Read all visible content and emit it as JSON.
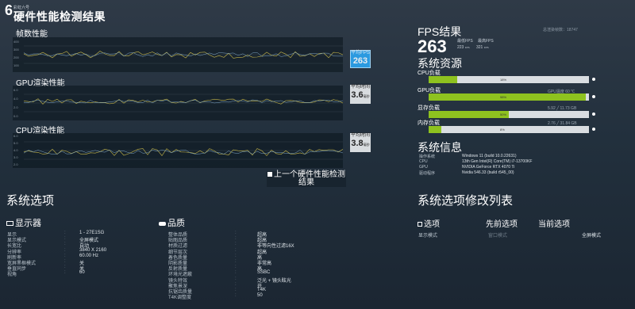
{
  "header": {
    "logo": "6",
    "sub": "彩虹六号",
    "title": "硬件性能检测结果"
  },
  "charts": [
    {
      "label": "帧数性能",
      "badge_label": "平均FPS",
      "badge_value": "263",
      "yticks": [
        "400",
        "300",
        "200",
        "100"
      ],
      "ylabel": "FPS"
    },
    {
      "label": "GPU渲染性能",
      "badge_label": "平均时间",
      "badge_value": "3.6",
      "badge_unit": "毫秒",
      "yticks": [
        "6.0",
        "4.0",
        "2.0",
        "0.0"
      ],
      "ylabel": "毫秒"
    },
    {
      "label": "CPU渲染性能",
      "badge_label": "平均时间",
      "badge_value": "3.8",
      "badge_unit": "毫秒",
      "yticks": [
        "6.0",
        "5.0",
        "4.0",
        "3.0",
        "2.0"
      ],
      "ylabel": "毫秒"
    }
  ],
  "fps": {
    "title": "FPS结果",
    "total_label": "总渲染帧数：",
    "total_value": "18747",
    "avg": "263",
    "min_label": "最低FPS",
    "max_label": "最高FPS",
    "min_value": "223",
    "max_value": "321",
    "min_unit": "FPS",
    "max_unit": "FPS"
  },
  "resources": {
    "title": "系统资源",
    "items": [
      {
        "label": "CPU负载",
        "pct": "18%",
        "fill": 0.18,
        "right": ""
      },
      {
        "label": "GPU负载",
        "pct": "98%",
        "fill": 0.98,
        "right": "GPU温度 60 ℃"
      },
      {
        "label": "显存负载",
        "pct": "50%",
        "fill": 0.5,
        "right": "5.92 ╱ 11.73 GB"
      },
      {
        "label": "内存负载",
        "pct": "8%",
        "fill": 0.08,
        "right": "2.76 ╱ 31.84 GB"
      }
    ]
  },
  "sysinfo": {
    "title": "系统信息",
    "rows": [
      [
        "操作系统",
        "Windows 11 (build 10.0.22631)"
      ],
      [
        "CPU",
        "13th Gen Intel(R) Core(TM) i7-13700KF"
      ],
      [
        "GPU",
        "NVIDIA GeForce RTX 4070 Ti"
      ],
      [
        "驱动程序",
        "Nvidia 546.33 (build r545_00)"
      ]
    ]
  },
  "center_button": "上一个硬件性能检测结果",
  "options": {
    "title": "系统选项",
    "display": {
      "title": "显示器",
      "rows": [
        [
          "显示",
          "1 - 27E1SG"
        ],
        [
          "显示模式",
          "全屏模式"
        ],
        [
          "长宽比",
          "自动"
        ],
        [
          "分辨率",
          "3840 X 2160"
        ],
        [
          "刷新率",
          "60.00 Hz"
        ],
        [
          "宽屏黑框模式",
          "关"
        ],
        [
          "垂直同步",
          "关"
        ],
        [
          "视角",
          "60"
        ]
      ]
    },
    "quality": {
      "title": "品质",
      "rows": [
        [
          "整体品质",
          "超高"
        ],
        [
          "贴图品质",
          "超高"
        ],
        [
          "材质过滤",
          "非等向性过滤16X"
        ],
        [
          "细节层次",
          "超高"
        ],
        [
          "着色质量",
          "高"
        ],
        [
          "阴影质量",
          "非常高"
        ],
        [
          "反射质量",
          "高"
        ],
        [
          "环境光遮蔽",
          "SSBC"
        ],
        [
          "镜头特效",
          "泛光 + 镜头眩光"
        ],
        [
          "聚焦景深",
          "开"
        ],
        [
          "抗锯齿质量",
          "T4K"
        ],
        [
          "T4K调整度",
          "50"
        ]
      ]
    }
  },
  "changes": {
    "title": "系统选项修改列表",
    "head": [
      "选项",
      "先前选项",
      "当前选项"
    ],
    "rows": [
      [
        "显示模式",
        "窗口模式",
        "全屏模式"
      ]
    ]
  }
}
